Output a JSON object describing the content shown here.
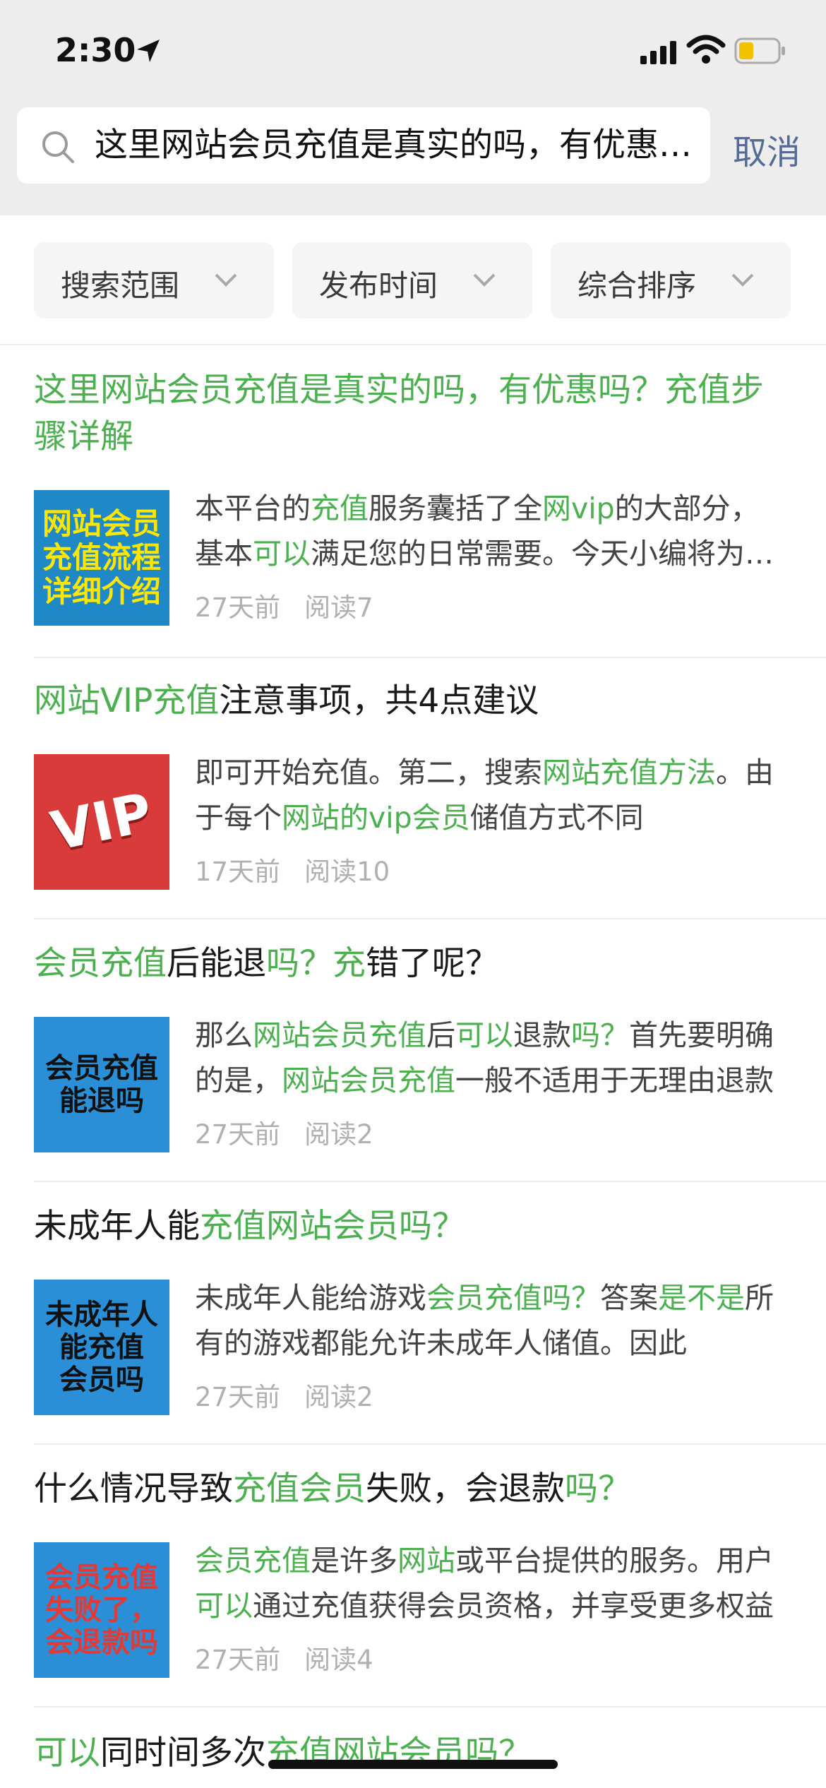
{
  "status": {
    "time": "2:30"
  },
  "search": {
    "query": "这里网站会员充值是真实的吗，有优惠吗？充值步骤详解",
    "cancel": "取消"
  },
  "filters": [
    {
      "label": "搜索范围"
    },
    {
      "label": "发布时间"
    },
    {
      "label": "综合排序"
    }
  ],
  "colors": {
    "highlight": "#4caf50",
    "cancel": "#566b94",
    "meta": "#b0b0b0"
  },
  "results": [
    {
      "title": [
        {
          "t": "这里网站会员充值是真实的吗，有优惠吗？充值步骤详解",
          "h": true
        }
      ],
      "thumb": {
        "text": "网站会员\n充值流程\n详细介绍",
        "bg": "#1f88c6",
        "fg": "#ffe600"
      },
      "snippet": [
        {
          "t": "本平台的",
          "h": false
        },
        {
          "t": "充值",
          "h": true
        },
        {
          "t": "服务囊括了全",
          "h": false
        },
        {
          "t": "网vip",
          "h": true
        },
        {
          "t": "的大部分，基本",
          "h": false
        },
        {
          "t": "可以",
          "h": true
        },
        {
          "t": "满足您的日常需要。今天小编将为您介绍",
          "h": false
        }
      ],
      "time": "27天前",
      "reads": "阅读7"
    },
    {
      "title": [
        {
          "t": "网站VIP充值",
          "h": true
        },
        {
          "t": "注意事项，共4点建议",
          "h": false
        }
      ],
      "thumb": {
        "text": "VIP",
        "bg": "#d93a3a",
        "fg": "#ffffff"
      },
      "snippet": [
        {
          "t": "即可开始充值。第二，搜索",
          "h": false
        },
        {
          "t": "网站充值方法",
          "h": true
        },
        {
          "t": "。由于每个",
          "h": false
        },
        {
          "t": "网站的vip会员",
          "h": true
        },
        {
          "t": "储值方式不同",
          "h": false
        }
      ],
      "time": "17天前",
      "reads": "阅读10"
    },
    {
      "title": [
        {
          "t": "会员充值",
          "h": true
        },
        {
          "t": "后能退",
          "h": false
        },
        {
          "t": "吗？充",
          "h": true
        },
        {
          "t": "错了呢？",
          "h": false
        }
      ],
      "thumb": {
        "text": "会员充值\n能退吗",
        "bg": "#2a8fd6",
        "fg": "#111111"
      },
      "snippet": [
        {
          "t": "那么",
          "h": false
        },
        {
          "t": "网站会员充值",
          "h": true
        },
        {
          "t": "后",
          "h": false
        },
        {
          "t": "可以",
          "h": true
        },
        {
          "t": "退款",
          "h": false
        },
        {
          "t": "吗？",
          "h": true
        },
        {
          "t": "首先要明确的是，",
          "h": false
        },
        {
          "t": "网站会员充值",
          "h": true
        },
        {
          "t": "一般不适用于无理由退款",
          "h": false
        }
      ],
      "time": "27天前",
      "reads": "阅读2"
    },
    {
      "title": [
        {
          "t": "未成年人能",
          "h": false
        },
        {
          "t": "充值网站会员吗？",
          "h": true
        }
      ],
      "thumb": {
        "text": "未成年人\n能充值\n会员吗",
        "bg": "#2a8fd6",
        "fg": "#111111"
      },
      "snippet": [
        {
          "t": "未成年人能给游戏",
          "h": false
        },
        {
          "t": "会员充值吗？",
          "h": true
        },
        {
          "t": "答案",
          "h": false
        },
        {
          "t": "是不是",
          "h": true
        },
        {
          "t": "所有的游戏都能允许未成年人储值。因此",
          "h": false
        }
      ],
      "time": "27天前",
      "reads": "阅读2"
    },
    {
      "title": [
        {
          "t": "什么情况导致",
          "h": false
        },
        {
          "t": "充值会员",
          "h": true
        },
        {
          "t": "失败，会退款",
          "h": false
        },
        {
          "t": "吗？",
          "h": true
        }
      ],
      "thumb": {
        "text": "会员充值\n失败了，\n会退款吗",
        "bg": "#2a8fd6",
        "fg": "#e53935"
      },
      "snippet": [
        {
          "t": "会员充值",
          "h": true
        },
        {
          "t": "是",
          "h": false
        },
        {
          "t": "许多",
          "h": false
        },
        {
          "t": "网站",
          "h": true
        },
        {
          "t": "或平台提供的服务。用户",
          "h": false
        },
        {
          "t": "可以",
          "h": true
        },
        {
          "t": "通过充值获得会员资格，并享受更多权益",
          "h": false
        }
      ],
      "time": "27天前",
      "reads": "阅读4"
    },
    {
      "title": [
        {
          "t": "可以",
          "h": true
        },
        {
          "t": "同时间多次",
          "h": false
        },
        {
          "t": "充值网站会员吗？",
          "h": true
        }
      ]
    }
  ]
}
